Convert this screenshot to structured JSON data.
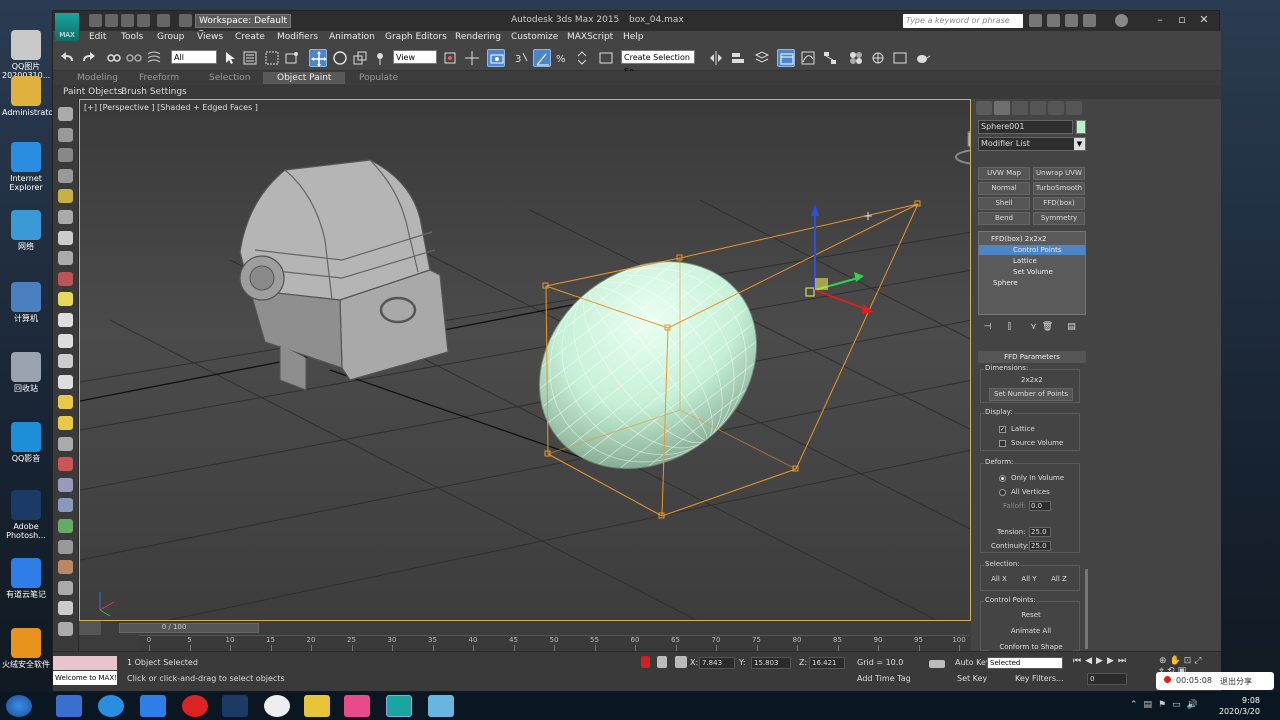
{
  "desktop": {
    "icons": [
      {
        "label": "QQ图片20200310...",
        "color": "#c9c9c9"
      },
      {
        "label": "Administrator",
        "color": "#e0b040"
      },
      {
        "label": "Internet Explorer",
        "color": "#2a8ee0"
      },
      {
        "label": "网络",
        "color": "#3a9ad8"
      },
      {
        "label": "计算机",
        "color": "#4a7fc0"
      },
      {
        "label": "回收站",
        "color": "#9aa4b0"
      },
      {
        "label": "QQ影音",
        "color": "#1d8fd8"
      },
      {
        "label": "Adobe Photosh...",
        "color": "#1c3a66"
      },
      {
        "label": "有道云笔记",
        "color": "#2f7ee8"
      },
      {
        "label": "火绒安全软件",
        "color": "#e8941c"
      }
    ]
  },
  "titlebar": {
    "logo": "MAX",
    "workspace": "Workspace: Default",
    "app_title": "Autodesk 3ds Max  2015",
    "file_title": "box_04.max",
    "search_placeholder": "Type a keyword or phrase"
  },
  "menu": [
    "Edit",
    "Tools",
    "Group",
    "Views",
    "Create",
    "Modifiers",
    "Animation",
    "Graph Editors",
    "Rendering",
    "Customize",
    "MAXScript",
    "Help"
  ],
  "toolbar": {
    "filter": "All",
    "ref_coord": "View",
    "selection_set": "Create Selection Se"
  },
  "ribbon": {
    "tabs": [
      "Modeling",
      "Freeform",
      "Selection",
      "Object Paint",
      "Populate"
    ],
    "active": "Object Paint",
    "sub": [
      "Paint Objects",
      "Brush Settings"
    ]
  },
  "viewport": {
    "label": "[+] [Perspective ] [Shaded + Edged Faces ]"
  },
  "timeline": {
    "frame": "0 / 100",
    "ticks": [
      "0",
      "5",
      "10",
      "15",
      "20",
      "25",
      "30",
      "35",
      "40",
      "45",
      "50",
      "55",
      "60",
      "65",
      "70",
      "75",
      "80",
      "85",
      "90",
      "95",
      "100"
    ]
  },
  "status": {
    "maxscript_text": "Welcome to MAX!",
    "selected": "1 Object Selected",
    "prompt": "Click or click-and-drag to select objects",
    "x_label": "X:",
    "x": "7.843",
    "y_label": "Y:",
    "y": "15.803",
    "z_label": "Z:",
    "z": "16.421",
    "grid": "Grid = 10.0",
    "add_time_tag": "Add Time Tag",
    "auto_key": "Auto Key",
    "set_key": "Set Key",
    "key_mode": "Selected",
    "key_filters": "Key Filters...",
    "frame_field": "0"
  },
  "command_panel": {
    "object_name": "Sphere001",
    "object_color": "#b8f0c8",
    "modifier_list": "Modifier List",
    "mod_buttons": [
      "UVW Map",
      "Unwrap UVW",
      "Normal",
      "TurboSmooth",
      "Shell",
      "FFD(box)",
      "Bend",
      "Symmetry"
    ],
    "stack": [
      {
        "label": "FFD(box) 2x2x2",
        "selected": false
      },
      {
        "label": "Control Points",
        "selected": true
      },
      {
        "label": "Lattice",
        "selected": false
      },
      {
        "label": "Set Volume",
        "selected": false
      },
      {
        "label": "Sphere",
        "selected": false
      }
    ],
    "rollout_title": "FFD Parameters",
    "dimensions_label": "Dimensions:",
    "dimensions_value": "2x2x2",
    "set_points_button": "Set Number of Points",
    "display_label": "Display:",
    "lattice": "Lattice",
    "source_volume": "Source Volume",
    "deform_label": "Deform:",
    "only_in_volume": "Only In Volume",
    "all_vertices": "All Vertices",
    "falloff_label": "Falloff:",
    "falloff_value": "0.0",
    "tension_label": "Tension:",
    "tension_value": "25.0",
    "continuity_label": "Continuity:",
    "continuity_value": "25.0",
    "selection_label": "Selection:",
    "sel_buttons": [
      "All X",
      "All Y",
      "All Z"
    ],
    "control_points_label": "Control Points:",
    "reset_button": "Reset",
    "animate_all_button": "Animate All",
    "conform_button": "Conform to Shape"
  },
  "recorder": {
    "time": "00:05:08",
    "exit": "退出分享"
  },
  "taskbar": {
    "time": "9:08",
    "date": "2020/3/20"
  },
  "colors": {
    "selection_blue": "#4d86c8",
    "lattice_orange": "#e8962c",
    "egg_mint": "#c8f5dc"
  }
}
